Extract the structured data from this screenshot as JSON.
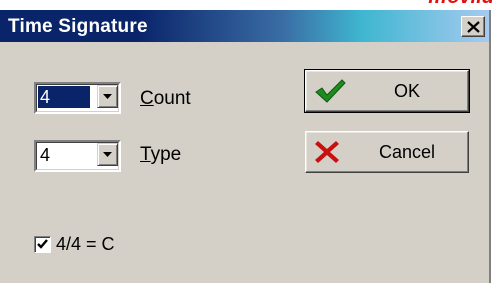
{
  "window": {
    "title": "Time Signature",
    "overflow_text": "…oviiu",
    "close_icon": "close-x-icon"
  },
  "count": {
    "value": "4",
    "label_accel": "C",
    "label_rest": "ount"
  },
  "type": {
    "value": "4",
    "label_accel": "T",
    "label_rest": "ype"
  },
  "buttons": {
    "ok_label": "OK",
    "ok_icon": "checkmark-icon",
    "cancel_label": "Cancel",
    "cancel_icon": "red-x-icon"
  },
  "common_time": {
    "checked": true,
    "label": "4/4 = C"
  },
  "colors": {
    "title_bar_start": "#0a246a",
    "title_bar_end": "#a6caf0",
    "dialog_bg": "#d4d0c8",
    "ok_check": "#1f8a1f",
    "cancel_x": "#c81010"
  }
}
